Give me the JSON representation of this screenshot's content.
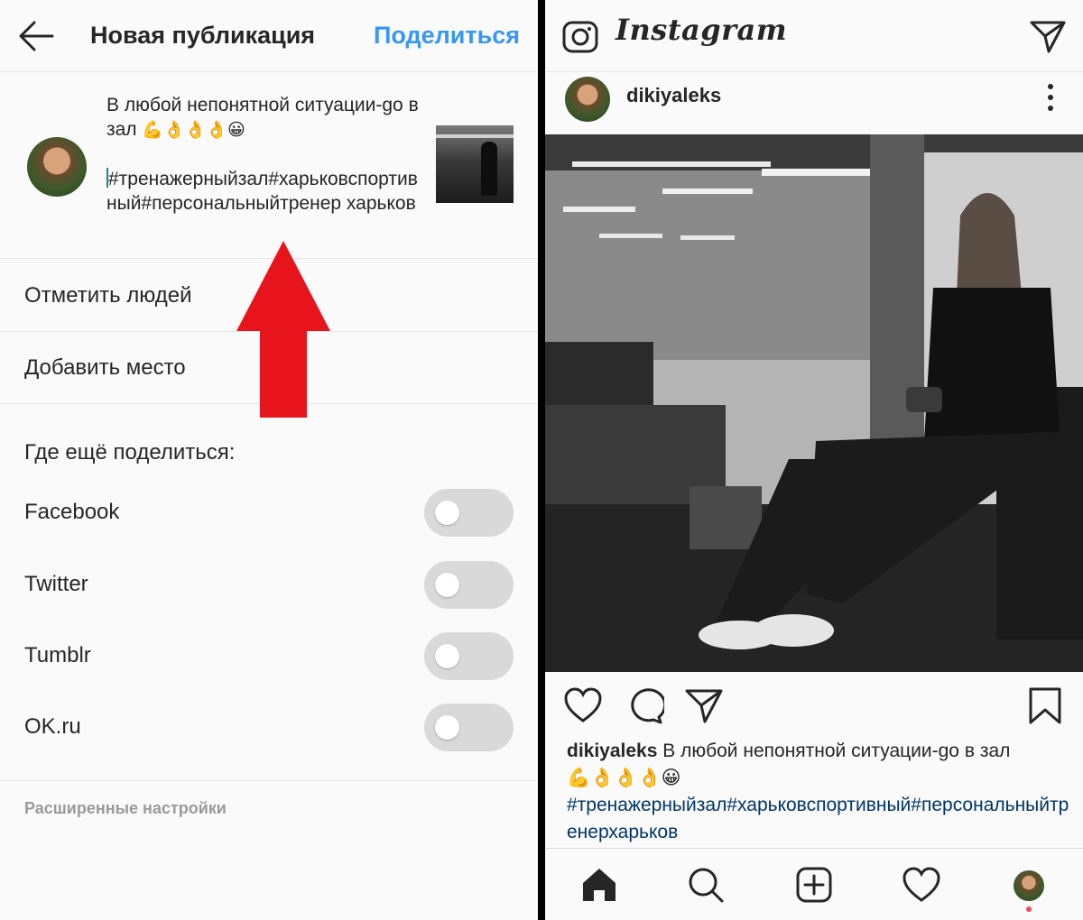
{
  "left": {
    "header": {
      "title": "Новая публикация",
      "share_label": "Поделиться"
    },
    "caption": {
      "text_line": "В любой непонятной ситуации-go в зал",
      "emojis": "💪👌👌👌😀",
      "hashtags": "#тренажерныйзал#харьковспортивный#персональныйтренер харьков"
    },
    "rows": {
      "tag_people": "Отметить людей",
      "add_location": "Добавить место"
    },
    "share_elsewhere": {
      "title": "Где ещё поделиться:",
      "targets": [
        {
          "label": "Facebook",
          "enabled": false
        },
        {
          "label": "Twitter",
          "enabled": false
        },
        {
          "label": "Tumblr",
          "enabled": false
        },
        {
          "label": "OK.ru",
          "enabled": false
        }
      ]
    },
    "advanced_settings": "Расширенные настройки",
    "annotation_arrow_color": "#e8141c"
  },
  "right": {
    "header": {
      "logo_text": "Instagram"
    },
    "post": {
      "username": "dikiyaleks",
      "caption_text": "В любой непонятной ситуации-go в зал",
      "emojis": "💪👌👌👌😀",
      "hashtags": "#тренажерныйзал#харьковспортивный#персональныйтренерхарьков"
    },
    "colors": {
      "link_blue": "#3897f0",
      "hashtag_navy": "#003569",
      "notification_red": "#ed4956"
    }
  }
}
